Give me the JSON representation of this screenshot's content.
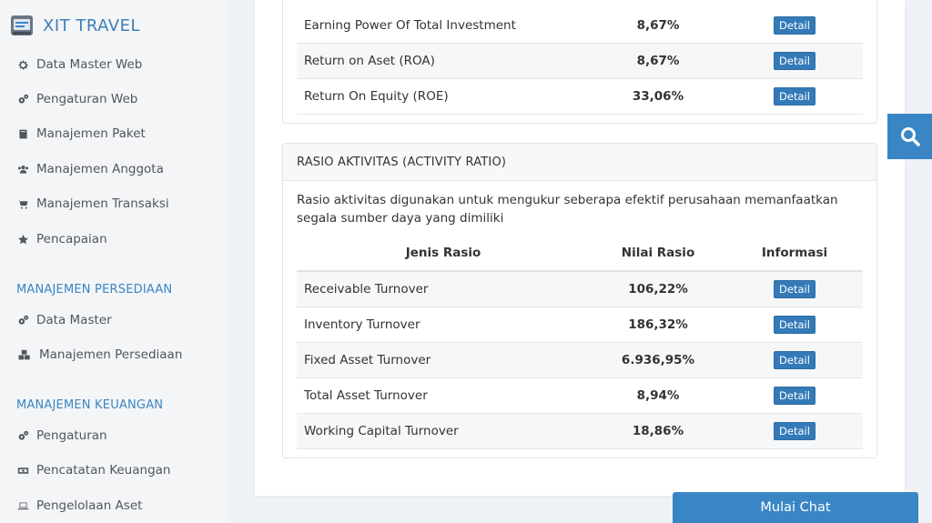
{
  "brand": {
    "name": "XIT TRAVEL"
  },
  "sidebar": {
    "items": [
      {
        "label": "Data Master Web",
        "icon": "gear-icon"
      },
      {
        "label": "Pengaturan Web",
        "icon": "gears-icon"
      },
      {
        "label": "Manajemen Paket",
        "icon": "book-icon"
      },
      {
        "label": "Manajemen Anggota",
        "icon": "users-icon"
      },
      {
        "label": "Manajemen Transaksi",
        "icon": "cart-icon"
      },
      {
        "label": "Pencapaian",
        "icon": "star-icon"
      }
    ],
    "section_persediaan": "MANAJEMEN PERSEDIAAN",
    "persediaan_items": [
      {
        "label": "Data Master",
        "icon": "gears-icon"
      },
      {
        "label": "Manajemen Persediaan",
        "icon": "cubes-icon"
      }
    ],
    "section_keuangan": "MANAJEMEN KEUANGAN",
    "keuangan_items": [
      {
        "label": "Pengaturan",
        "icon": "gears-icon"
      },
      {
        "label": "Pencatatan Keuangan",
        "icon": "money-icon"
      },
      {
        "label": "Pengelolaan Aset",
        "icon": "laptop-icon"
      }
    ]
  },
  "profitability": {
    "rows": [
      {
        "name": "Earning Power Of Total Investment",
        "value": "8,67%",
        "action": "Detail"
      },
      {
        "name": "Return on Aset (ROA)",
        "value": "8,67%",
        "action": "Detail"
      },
      {
        "name": "Return On Equity (ROE)",
        "value": "33,06%",
        "action": "Detail"
      }
    ]
  },
  "activity": {
    "title": "RASIO AKTIVITAS (ACTIVITY RATIO)",
    "description": "Rasio aktivitas digunakan untuk mengukur seberapa efektif perusahaan memanfaatkan segala sumber daya yang dimiliki",
    "columns": [
      "Jenis Rasio",
      "Nilai Rasio",
      "Informasi"
    ],
    "rows": [
      {
        "name": "Receivable Turnover",
        "value": "106,22%",
        "action": "Detail"
      },
      {
        "name": "Inventory Turnover",
        "value": "186,32%",
        "action": "Detail"
      },
      {
        "name": "Fixed Asset Turnover",
        "value": "6.936,95%",
        "action": "Detail"
      },
      {
        "name": "Total Asset Turnover",
        "value": "8,94%",
        "action": "Detail"
      },
      {
        "name": "Working Capital Turnover",
        "value": "18,86%",
        "action": "Detail"
      }
    ]
  },
  "chat": {
    "label": "Mulai Chat"
  },
  "colors": {
    "accent": "#3a86c5",
    "button": "#337ab7"
  }
}
